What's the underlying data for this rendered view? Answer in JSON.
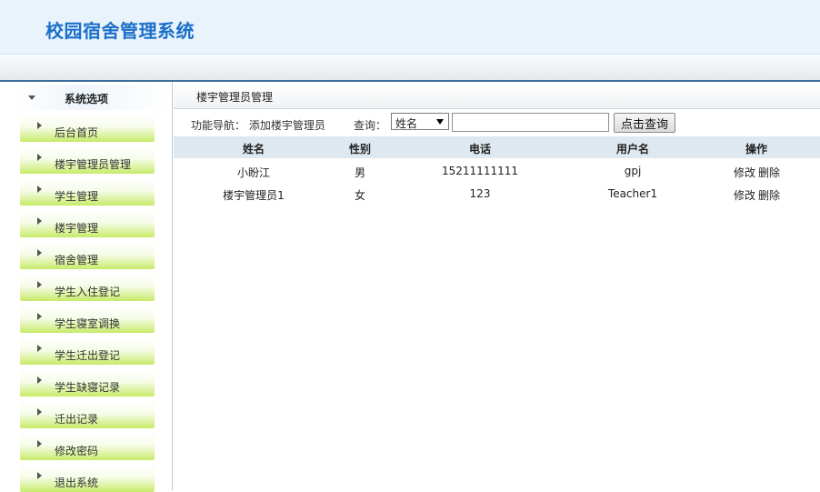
{
  "app": {
    "title": "校园宿舍管理系统"
  },
  "sidebar": {
    "header": "系统选项",
    "items": [
      {
        "label": "后台首页"
      },
      {
        "label": "楼宇管理员管理"
      },
      {
        "label": "学生管理"
      },
      {
        "label": "楼宇管理"
      },
      {
        "label": "宿舍管理"
      },
      {
        "label": "学生入住登记"
      },
      {
        "label": "学生寝室调换"
      },
      {
        "label": "学生迁出登记"
      },
      {
        "label": "学生缺寝记录"
      },
      {
        "label": "迁出记录"
      },
      {
        "label": "修改密码"
      },
      {
        "label": "退出系统"
      }
    ]
  },
  "content": {
    "title": "楼宇管理员管理",
    "nav_label": "功能导航：",
    "nav_link": "添加楼宇管理员",
    "query_label": "查询：",
    "query_select_value": "姓名",
    "query_input_value": "",
    "query_button": "点击查询"
  },
  "table": {
    "columns": [
      "姓名",
      "性别",
      "电话",
      "用户名",
      "操作"
    ],
    "rows": [
      {
        "name": "小盼江",
        "gender": "男",
        "phone": "15211111111",
        "username": "gpj",
        "edit": "修改",
        "delete": "删除"
      },
      {
        "name": "楼宇管理员1",
        "gender": "女",
        "phone": "123",
        "username": "Teacher1",
        "edit": "修改",
        "delete": "删除"
      }
    ]
  },
  "colors": {
    "title": "#1b6fc9",
    "header_bg": "#e8f3fc",
    "table_head_bg": "#dde8f1",
    "menu_green": "#c6ea66"
  }
}
